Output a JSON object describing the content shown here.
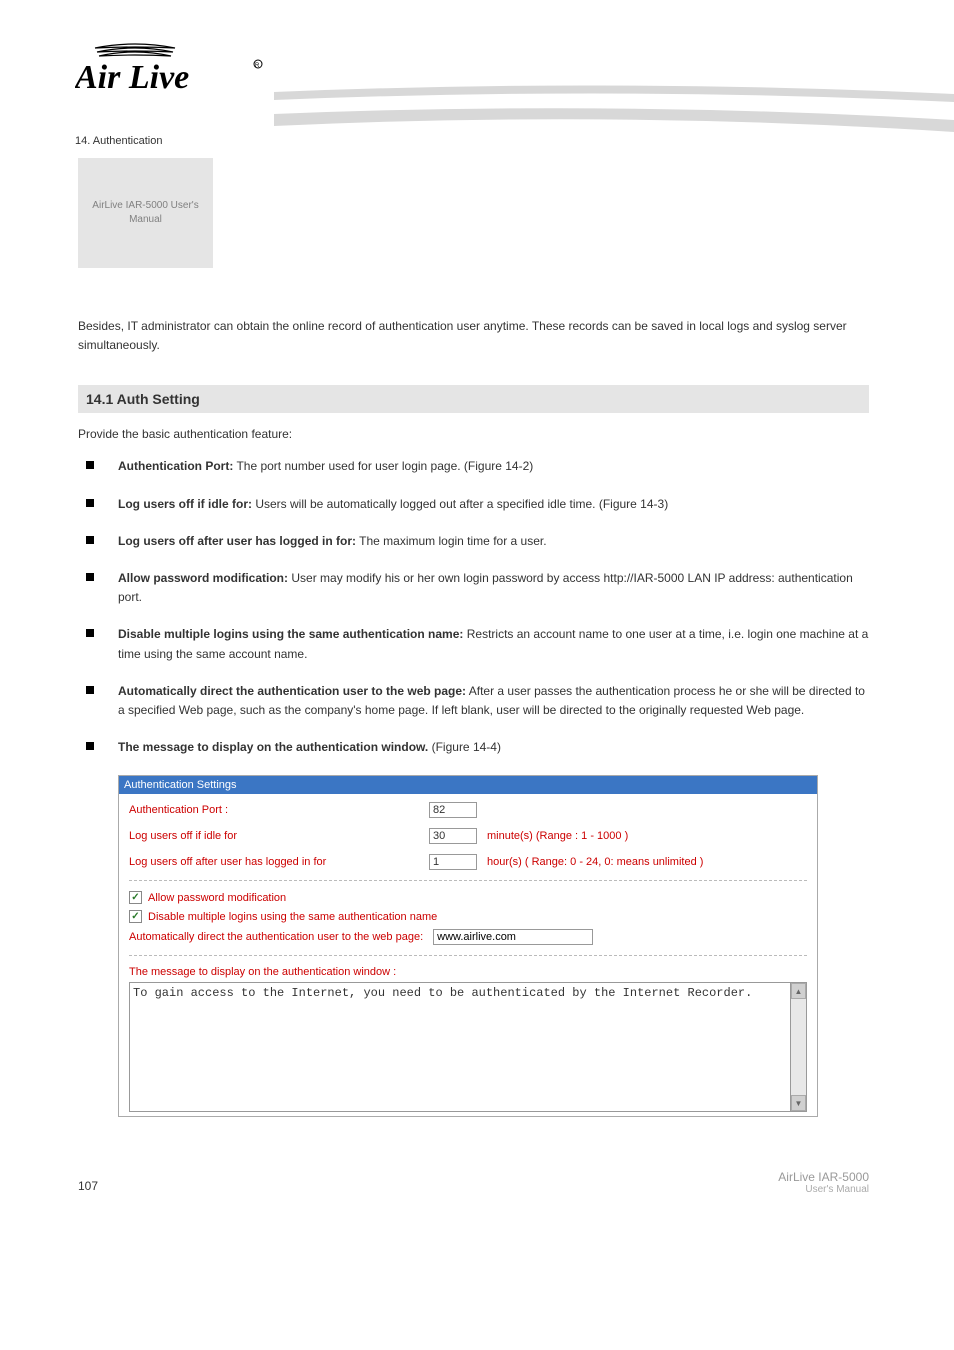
{
  "chapter_label": "14. Authentication",
  "gray_box": "AirLive IAR-5000 User's Manual",
  "intro_text": "Besides, IT administrator can obtain the online record of authentication user anytime. These records can be saved in local logs and syslog server simultaneously.",
  "section_header": "14.1 Auth Setting",
  "feature_intro": "Provide the basic authentication feature:",
  "features": [
    {
      "label": "Authentication Port:",
      "desc": " The port number used for user login page. (Figure 14-2)"
    },
    {
      "label": "Log users off if idle for:",
      "desc": " Users will be automatically logged out after a specified idle time. (Figure 14-3)"
    },
    {
      "label": "Log users off after user has logged in for:",
      "desc": " The maximum login time for a user."
    },
    {
      "label": "Allow password modification:",
      "desc": " User may modify his or her own login password by access http://IAR-5000 LAN IP address: authentication port."
    },
    {
      "label": "Disable multiple logins using the same authentication name:",
      "desc": " Restricts an account name to one user at a time, i.e. login one machine at a time using the same account name."
    },
    {
      "label": "Automatically direct the authentication user to the web page:",
      "desc": " After a user passes the authentication process he or she will be directed to a specified Web page, such as the company's home page. If left blank, user will be directed to the originally requested Web page."
    },
    {
      "label": "The message to display on the authentication window.",
      "desc": " (Figure 14-4)"
    }
  ],
  "screenshot": {
    "title": "Authentication Settings",
    "port_label": "Authentication Port :",
    "port_value": "82",
    "idle_label": "Log users off if idle for",
    "idle_value": "30",
    "idle_hint": "minute(s) (Range : 1 - 1000 )",
    "logged_label": "Log users off after user has logged in for",
    "logged_value": "1",
    "logged_hint": "hour(s) ( Range: 0 - 24, 0: means unlimited )",
    "cb1_label": "Allow password modification",
    "cb2_label": "Disable multiple logins using the same authentication name",
    "redirect_label": "Automatically direct the authentication user to the web page:",
    "redirect_value": "www.airlive.com",
    "msg_label": "The message to display on the authentication window :",
    "msg_value": "To gain access to the Internet, you need to be authenticated by the Internet Recorder."
  },
  "footer": {
    "page": "107",
    "brand": "AirLive IAR-5000",
    "model": "User's Manual"
  }
}
